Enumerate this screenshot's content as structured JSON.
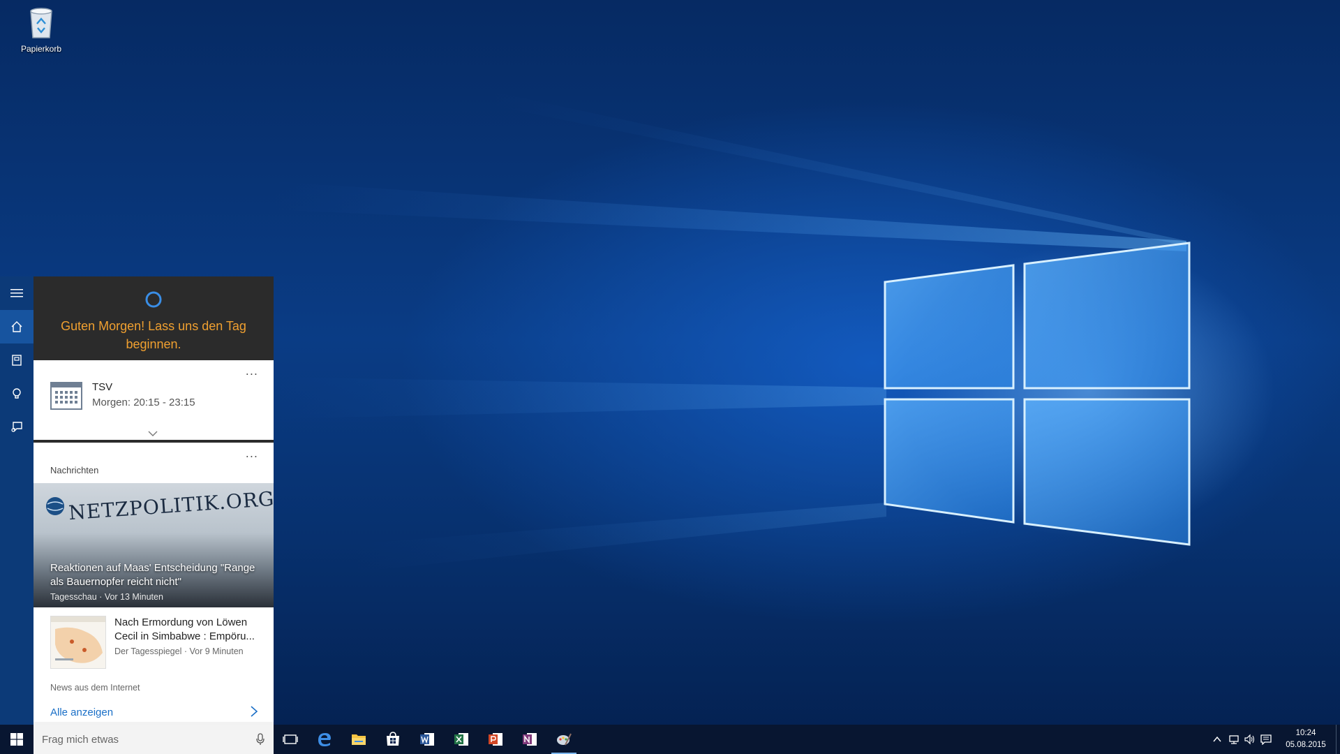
{
  "desktop": {
    "icons": [
      {
        "label": "Papierkorb",
        "icon": "recycle-bin-icon"
      }
    ]
  },
  "cortana": {
    "greeting": "Guten Morgen! Lass uns den Tag beginnen.",
    "rail": [
      {
        "name": "menu",
        "icon": "hamburger-icon",
        "active": false
      },
      {
        "name": "home",
        "icon": "home-icon",
        "active": true
      },
      {
        "name": "notebook",
        "icon": "notebook-icon",
        "active": false
      },
      {
        "name": "reminders",
        "icon": "lightbulb-icon",
        "active": false
      },
      {
        "name": "feedback",
        "icon": "feedback-icon",
        "active": false
      }
    ],
    "calendar_card": {
      "more": "...",
      "title": "TSV",
      "time": "Morgen: 20:15 - 23:15"
    },
    "news_card": {
      "more": "...",
      "heading": "Nachrichten",
      "hero": {
        "image_text": "NETZPOLITIK.ORG",
        "title": "Reaktionen auf Maas' Entscheidung \"Range als Bauernopfer reicht nicht\"",
        "source": "Tagesschau · Vor 13 Minuten"
      },
      "item2": {
        "title": "Nach Ermordung von Löwen Cecil in Simbabwe : Empöru...",
        "source": "Der Tagesspiegel · Vor 9 Minuten"
      },
      "footer": "News aus dem Internet",
      "show_all": "Alle anzeigen"
    }
  },
  "taskbar": {
    "search_placeholder": "Frag mich etwas",
    "apps": [
      {
        "name": "task-view",
        "icon": "task-view-icon",
        "running": false
      },
      {
        "name": "edge",
        "icon": "edge-icon",
        "running": false
      },
      {
        "name": "file-explorer",
        "icon": "folder-icon",
        "running": false
      },
      {
        "name": "store",
        "icon": "store-icon",
        "running": false
      },
      {
        "name": "word",
        "icon": "word-icon",
        "running": false
      },
      {
        "name": "excel",
        "icon": "excel-icon",
        "running": false
      },
      {
        "name": "powerpoint",
        "icon": "powerpoint-icon",
        "running": false
      },
      {
        "name": "onenote",
        "icon": "onenote-icon",
        "running": false
      },
      {
        "name": "paint",
        "icon": "paint-icon",
        "running": true
      }
    ],
    "clock": {
      "time": "10:24",
      "date": "05.08.2015"
    },
    "colors": {
      "word": "#2b579a",
      "excel": "#217346",
      "powerpoint": "#d24726",
      "onenote": "#80397b",
      "accent": "#f0a030"
    }
  }
}
